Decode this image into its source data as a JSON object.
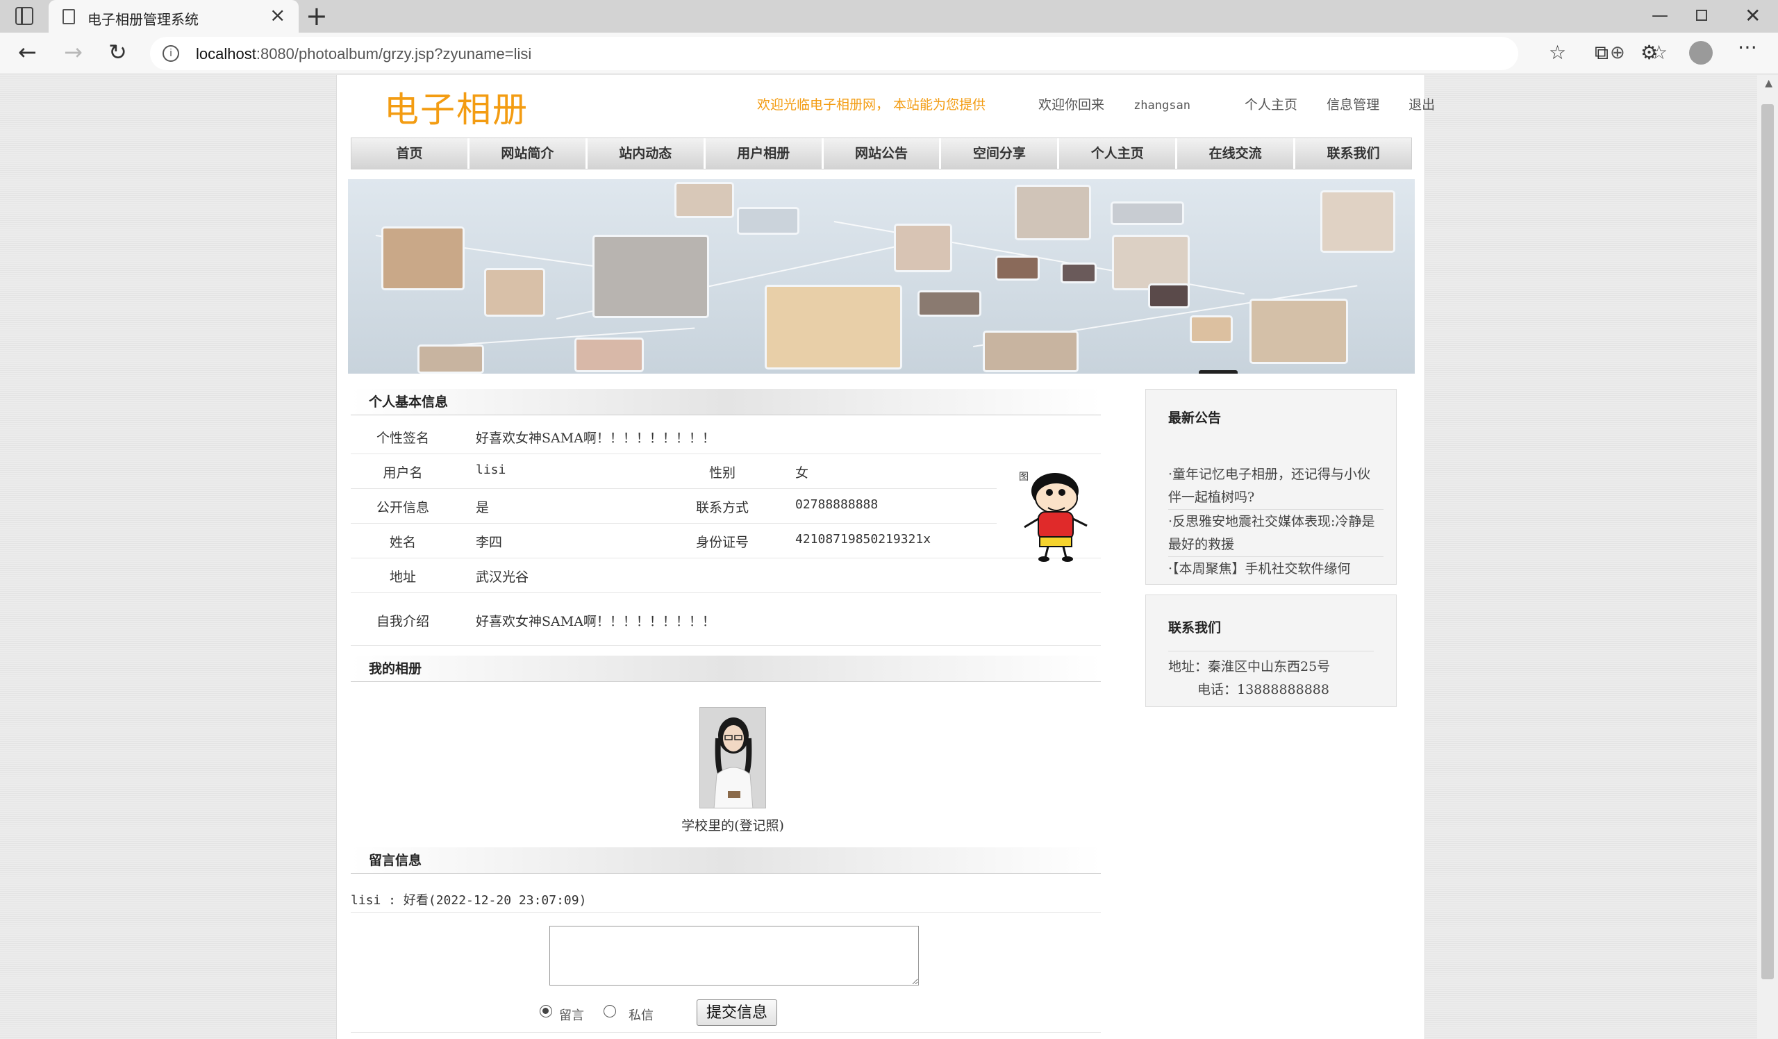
{
  "browser": {
    "tab_title": "电子相册管理系统",
    "url_host": "localhost",
    "url_rest": ":8080/photoalbum/grzy.jsp?zyuname=lisi"
  },
  "header": {
    "logo": "电子相册",
    "marquee": "欢迎光临电子相册网， 本站能为您提供",
    "welcome_prefix": "欢迎你回来",
    "username": "zhangsan",
    "link_home": "个人主页",
    "link_manage": "信息管理",
    "link_logout": "退出"
  },
  "nav": [
    "首页",
    "网站简介",
    "站内动态",
    "用户相册",
    "网站公告",
    "空间分享",
    "个人主页",
    "在线交流",
    "联系我们"
  ],
  "profile": {
    "section_title": "个人基本信息",
    "signature_label": "个性签名",
    "signature": "好喜欢女神SAMA啊！！！！！！！！！",
    "username_label": "用户名",
    "username": "lisi",
    "gender_label": "性别",
    "gender": "女",
    "public_label": "公开信息",
    "public": "是",
    "contact_label": "联系方式",
    "contact": "02788888888",
    "name_label": "姓名",
    "name": "李四",
    "id_label": "身份证号",
    "id": "42108719850219321x",
    "address_label": "地址",
    "address": "武汉光谷",
    "intro_label": "自我介绍",
    "intro": "好喜欢女神SAMA啊！！！！！！！！！"
  },
  "album": {
    "section_title": "我的相册",
    "photos": [
      {
        "caption": "学校里的(登记照)"
      }
    ]
  },
  "messages": {
    "section_title": "留言信息",
    "items": [
      {
        "text": "lisi : 好看(2022-12-20 23:07:09)"
      }
    ],
    "radio_public": "留言",
    "radio_private": "私信",
    "submit": "提交信息"
  },
  "sidebar": {
    "notice_title": "最新公告",
    "notices": [
      "·童年记忆电子相册，还记得与小伙伴一起植树吗?",
      "·反思雅安地震社交媒体表现:冷静是最好的救援",
      "·【本周聚焦】手机社交软件缘何"
    ],
    "contact_title": "联系我们",
    "contact_address": "地址：秦淮区中山东西25号",
    "contact_phone": "电话：13888888888"
  }
}
